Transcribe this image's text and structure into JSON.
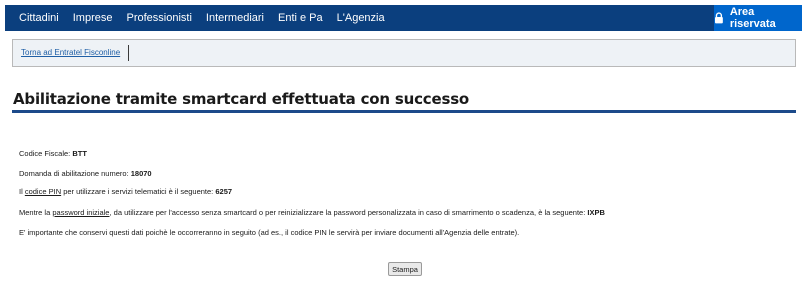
{
  "nav": {
    "items": [
      "Cittadini",
      "Imprese",
      "Professionisti",
      "Intermediari",
      "Enti e Pa",
      "L'Agenzia"
    ],
    "area_riservata": "Area riservata"
  },
  "backbar": {
    "link_label": "Torna ad Entratel Fisconline"
  },
  "page": {
    "title": "Abilitazione tramite smartcard effettuata con successo"
  },
  "details": {
    "codice_fiscale_label": "Codice Fiscale: ",
    "codice_fiscale_value": "BTT",
    "domanda_label": "Domanda di abilitazione numero: ",
    "domanda_value": "18070",
    "pin_prefix": "Il ",
    "pin_link": "codice PIN",
    "pin_suffix": " per utilizzare i servizi telematici è il seguente: ",
    "pin_value": "6257",
    "password_prefix": "Mentre la ",
    "password_link": "password iniziale",
    "password_suffix": ", da utilizzare per l'accesso senza smartcard o per reinizializzare la password personalizzata in caso di smarrimento o scadenza, è la seguente: ",
    "password_value": "IXPB",
    "note": "E' importante che conservi questi dati poichè le occorreranno in seguito (ad es., il codice PIN le servirà per inviare documenti all'Agenzia delle entrate)."
  },
  "actions": {
    "print_label": "Stampa"
  },
  "colors": {
    "topbar": "#0b3f7e",
    "area_riservata": "#0066cc",
    "title_rule": "#1c4a8a"
  },
  "icons": {
    "area_riservata_icon": "lock-icon"
  }
}
